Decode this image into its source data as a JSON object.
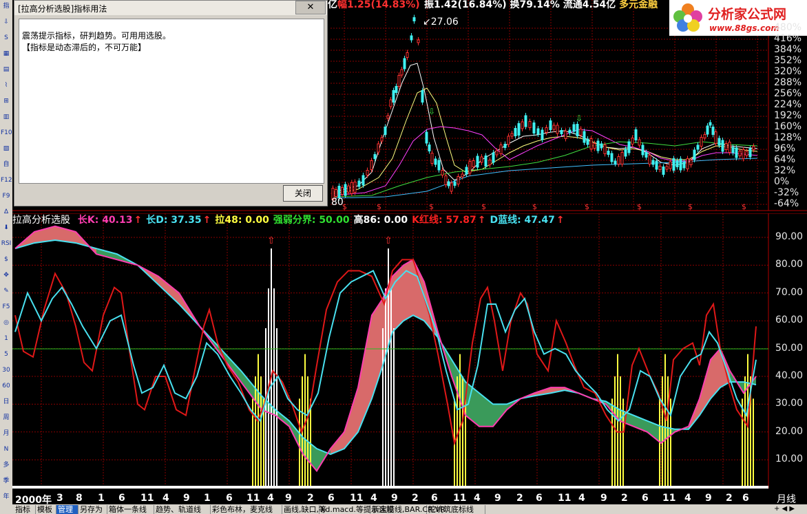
{
  "toolbar": {
    "items": [
      "指",
      "⇩",
      "S",
      "▦",
      "▤",
      "⌇",
      "⊞",
      "▥",
      "F10",
      "▨",
      "自",
      "F12",
      "F9",
      "∆",
      "⬇",
      "RSI",
      "$",
      "✥",
      "✎",
      "F5",
      "◎",
      "1",
      "5",
      "30",
      "60",
      "日",
      "周",
      "月",
      "N",
      "多",
      "季",
      "年"
    ]
  },
  "dialog": {
    "title": "[拉高分析选股]指标用法",
    "line1": "震荡提示指标，研判趋势。可用用选股。",
    "line2": "【指标是动态滞后的，不可万能】",
    "close_label": "关闭"
  },
  "header": {
    "fragment1": "亿",
    "fragment2": "幅1.25(14.83%)",
    "fragment3": "振1.42(16.84%)",
    "fragment4": "换79.14%",
    "fragment5": "流通4.54亿",
    "fragment6": "多元金融",
    "logo_name": "分析家公式网",
    "logo_url": "www.88gs.com"
  },
  "price_chart": {
    "peak_label": "27.06",
    "low_label": "80",
    "pct_labels": [
      "480%",
      "416%",
      "384%",
      "352%",
      "320%",
      "288%",
      "256%",
      "224%",
      "192%",
      "160%",
      "128%",
      "96%",
      "64%",
      "32%",
      "0%",
      "-32%",
      "-64%"
    ]
  },
  "indicator": {
    "name": "拉高分析选股",
    "items": [
      {
        "label": "长K:",
        "value": "40.13",
        "color": "#ff3db0"
      },
      {
        "label": "长D:",
        "value": "37.35",
        "color": "#49e1f0"
      },
      {
        "label": "拉48:",
        "value": "0.00",
        "color": "#ffff40"
      },
      {
        "label": "强弱分界:",
        "value": "50.00",
        "color": "#30e030"
      },
      {
        "label": "高86:",
        "value": "0.00",
        "color": "#ffffff"
      },
      {
        "label": "K红线:",
        "value": "57.87",
        "color": "#ff2020"
      },
      {
        "label": "D蓝线:",
        "value": "47.47",
        "color": "#49e1f0"
      }
    ],
    "y_labels": [
      "90.00",
      "80.00",
      "70.00",
      "60.00",
      "50.00",
      "40.00",
      "30.00",
      "20.00",
      "10.00"
    ]
  },
  "date_axis": {
    "labels": [
      "2000年",
      "3",
      "8",
      "1",
      "6",
      "11",
      "4",
      "9",
      "1",
      "6",
      "11",
      "4",
      "9",
      "2",
      "6",
      "11",
      "4",
      "9",
      "2",
      "6",
      "11",
      "4",
      "9",
      "2",
      "6",
      "11",
      "4",
      "9",
      "2",
      "6",
      "11",
      "4",
      "9",
      "2",
      "6"
    ],
    "period": "月线"
  },
  "tabs": [
    "指标",
    "模板",
    "管理",
    "另存为",
    "箱体一条线",
    "趋势、轨道线",
    "彩色布林，麦克线",
    "画线,缺口,等",
    "kd.macd.等提示选股",
    "新宝塔线,BAR.CR.VR",
    "挖坑筑底标线"
  ],
  "colors": {
    "up": "#ff3030",
    "down": "#3ff0f0",
    "fill_up": "#d86a6a",
    "fill_down": "#3a9a5a",
    "grid": "#b00000"
  }
}
